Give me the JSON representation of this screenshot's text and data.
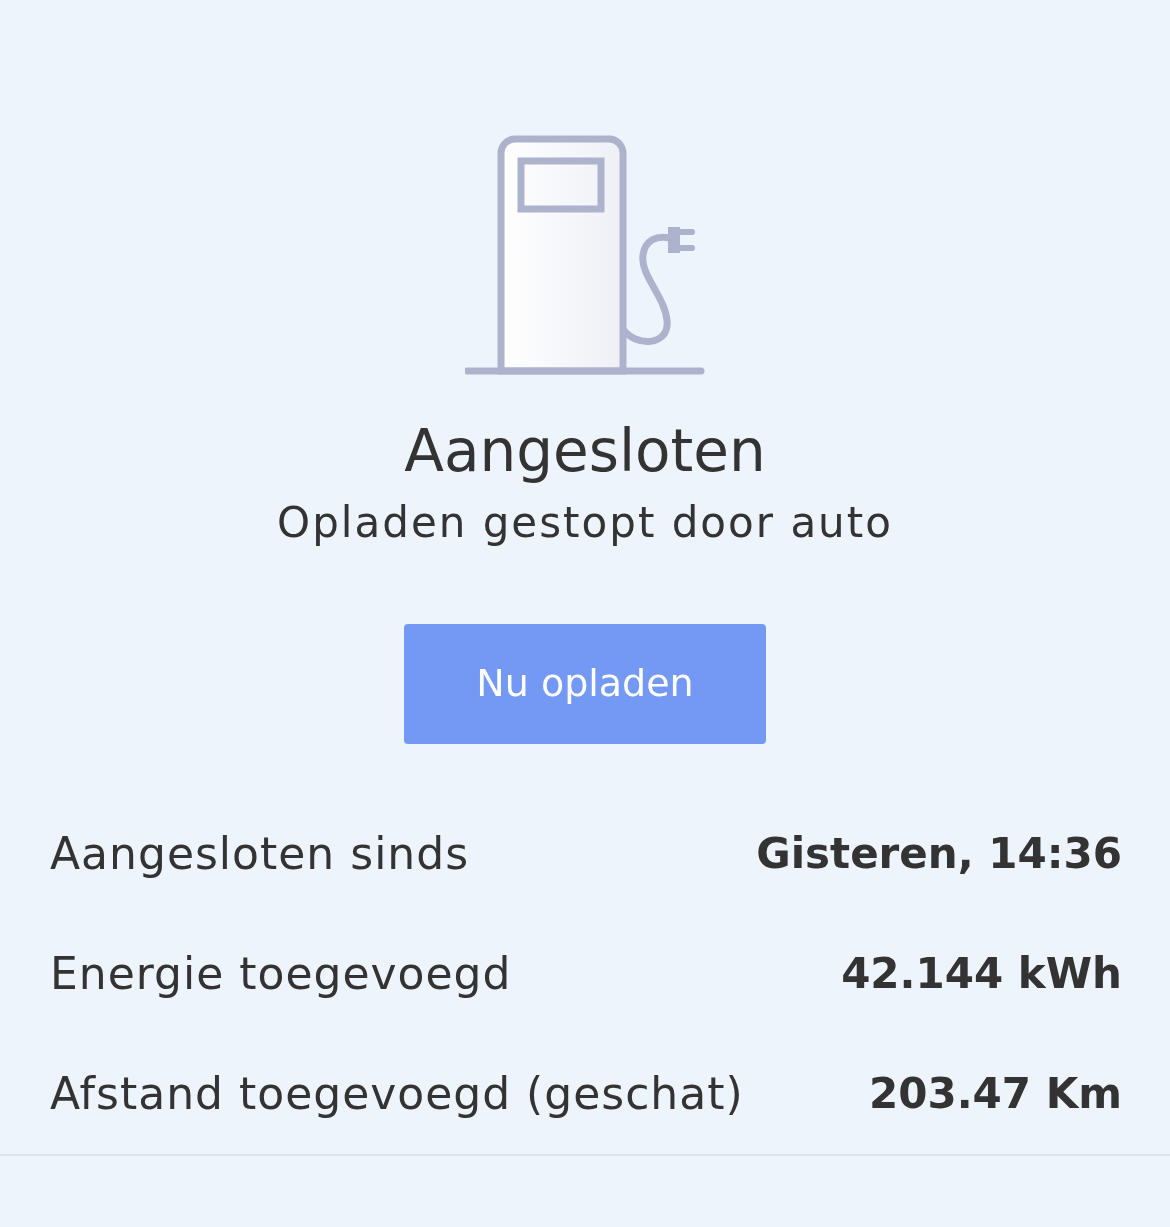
{
  "status": {
    "title": "Aangesloten",
    "subtitle": "Opladen gestopt door auto"
  },
  "button": {
    "label": "Nu opladen"
  },
  "details": [
    {
      "label": "Aangesloten sinds",
      "value": "Gisteren, 14:36"
    },
    {
      "label": "Energie toegevoegd",
      "value": "42.144 kWh"
    },
    {
      "label": "Afstand toegevoegd (geschat)",
      "value": "203.47 Km"
    }
  ]
}
